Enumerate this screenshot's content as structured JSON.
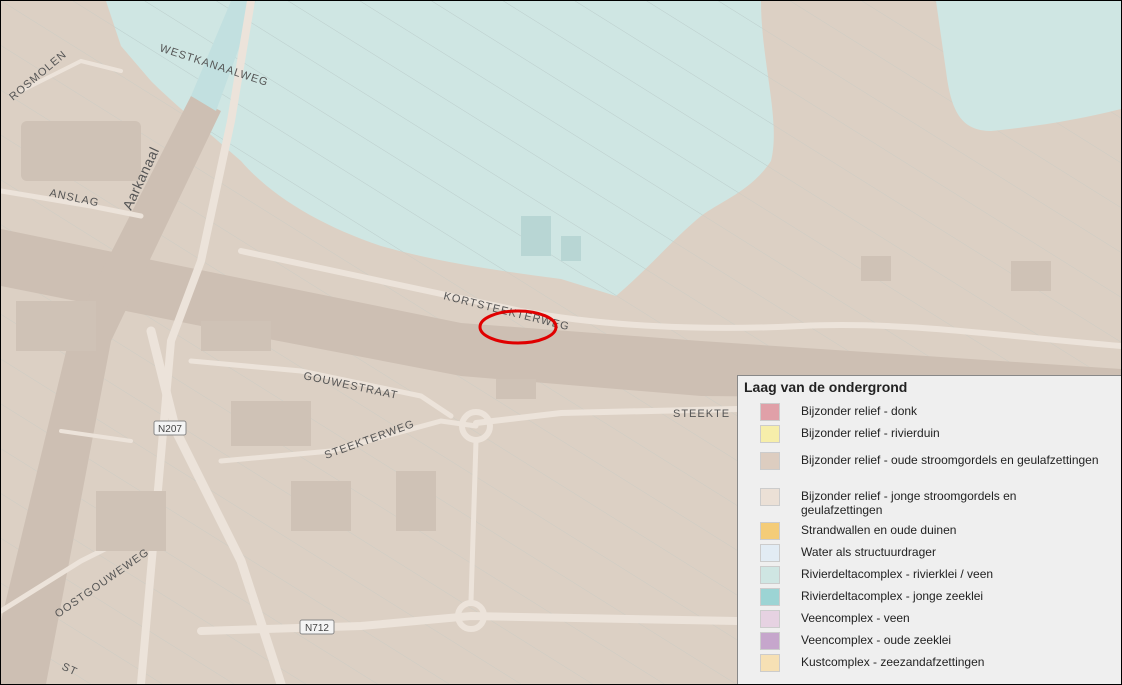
{
  "map": {
    "labels": {
      "rosmolen": "ROSMOLEN",
      "westkanaalweg": "WESTKANAALWEG",
      "anslag": "ANSLAG",
      "aarkanaal": "Aarkanaal",
      "kortsteekterweg": "KORTSTEEKTERWEG",
      "gouwestraat": "GOUWESTRAAT",
      "steekterweg": "STEEKTERWEG",
      "steekte": "STEEKTE",
      "oostgouweweg": "OOSTGOUWEWEG",
      "st": "ST",
      "n207": "N207",
      "n712": "N712"
    },
    "colors": {
      "base": "#dcd0c4",
      "clay": "#cfe6e3",
      "road": "#ece3da",
      "river": "#cdbfb3",
      "highlight": "#e00000"
    }
  },
  "legend": {
    "title": "Laag van de ondergrond",
    "items": [
      {
        "label": "Bijzonder relief - donk",
        "color": "#e0a0a8"
      },
      {
        "label": "Bijzonder relief - rivierduin",
        "color": "#f6eeaa"
      },
      {
        "label": "Bijzonder relief - oude stroomgordels en geulafzettingen",
        "color": "#ddcdc0"
      },
      {
        "label": "Bijzonder relief - jonge stroomgordels en geulafzettingen",
        "color": "#ebe0d6"
      },
      {
        "label": "Strandwallen en oude duinen",
        "color": "#f4cc78"
      },
      {
        "label": "Water als structuurdrager",
        "color": "#e2ecf4"
      },
      {
        "label": "Rivierdeltacomplex - rivierklei / veen",
        "color": "#cfe6e3"
      },
      {
        "label": "Rivierdeltacomplex - jonge zeeklei",
        "color": "#9cd4d4"
      },
      {
        "label": "Veencomplex - veen",
        "color": "#e6d2e2"
      },
      {
        "label": "Veencomplex - oude zeeklei",
        "color": "#c6a6cc"
      },
      {
        "label": "Kustcomplex - zeezandafzettingen",
        "color": "#f6e0b4"
      }
    ]
  }
}
